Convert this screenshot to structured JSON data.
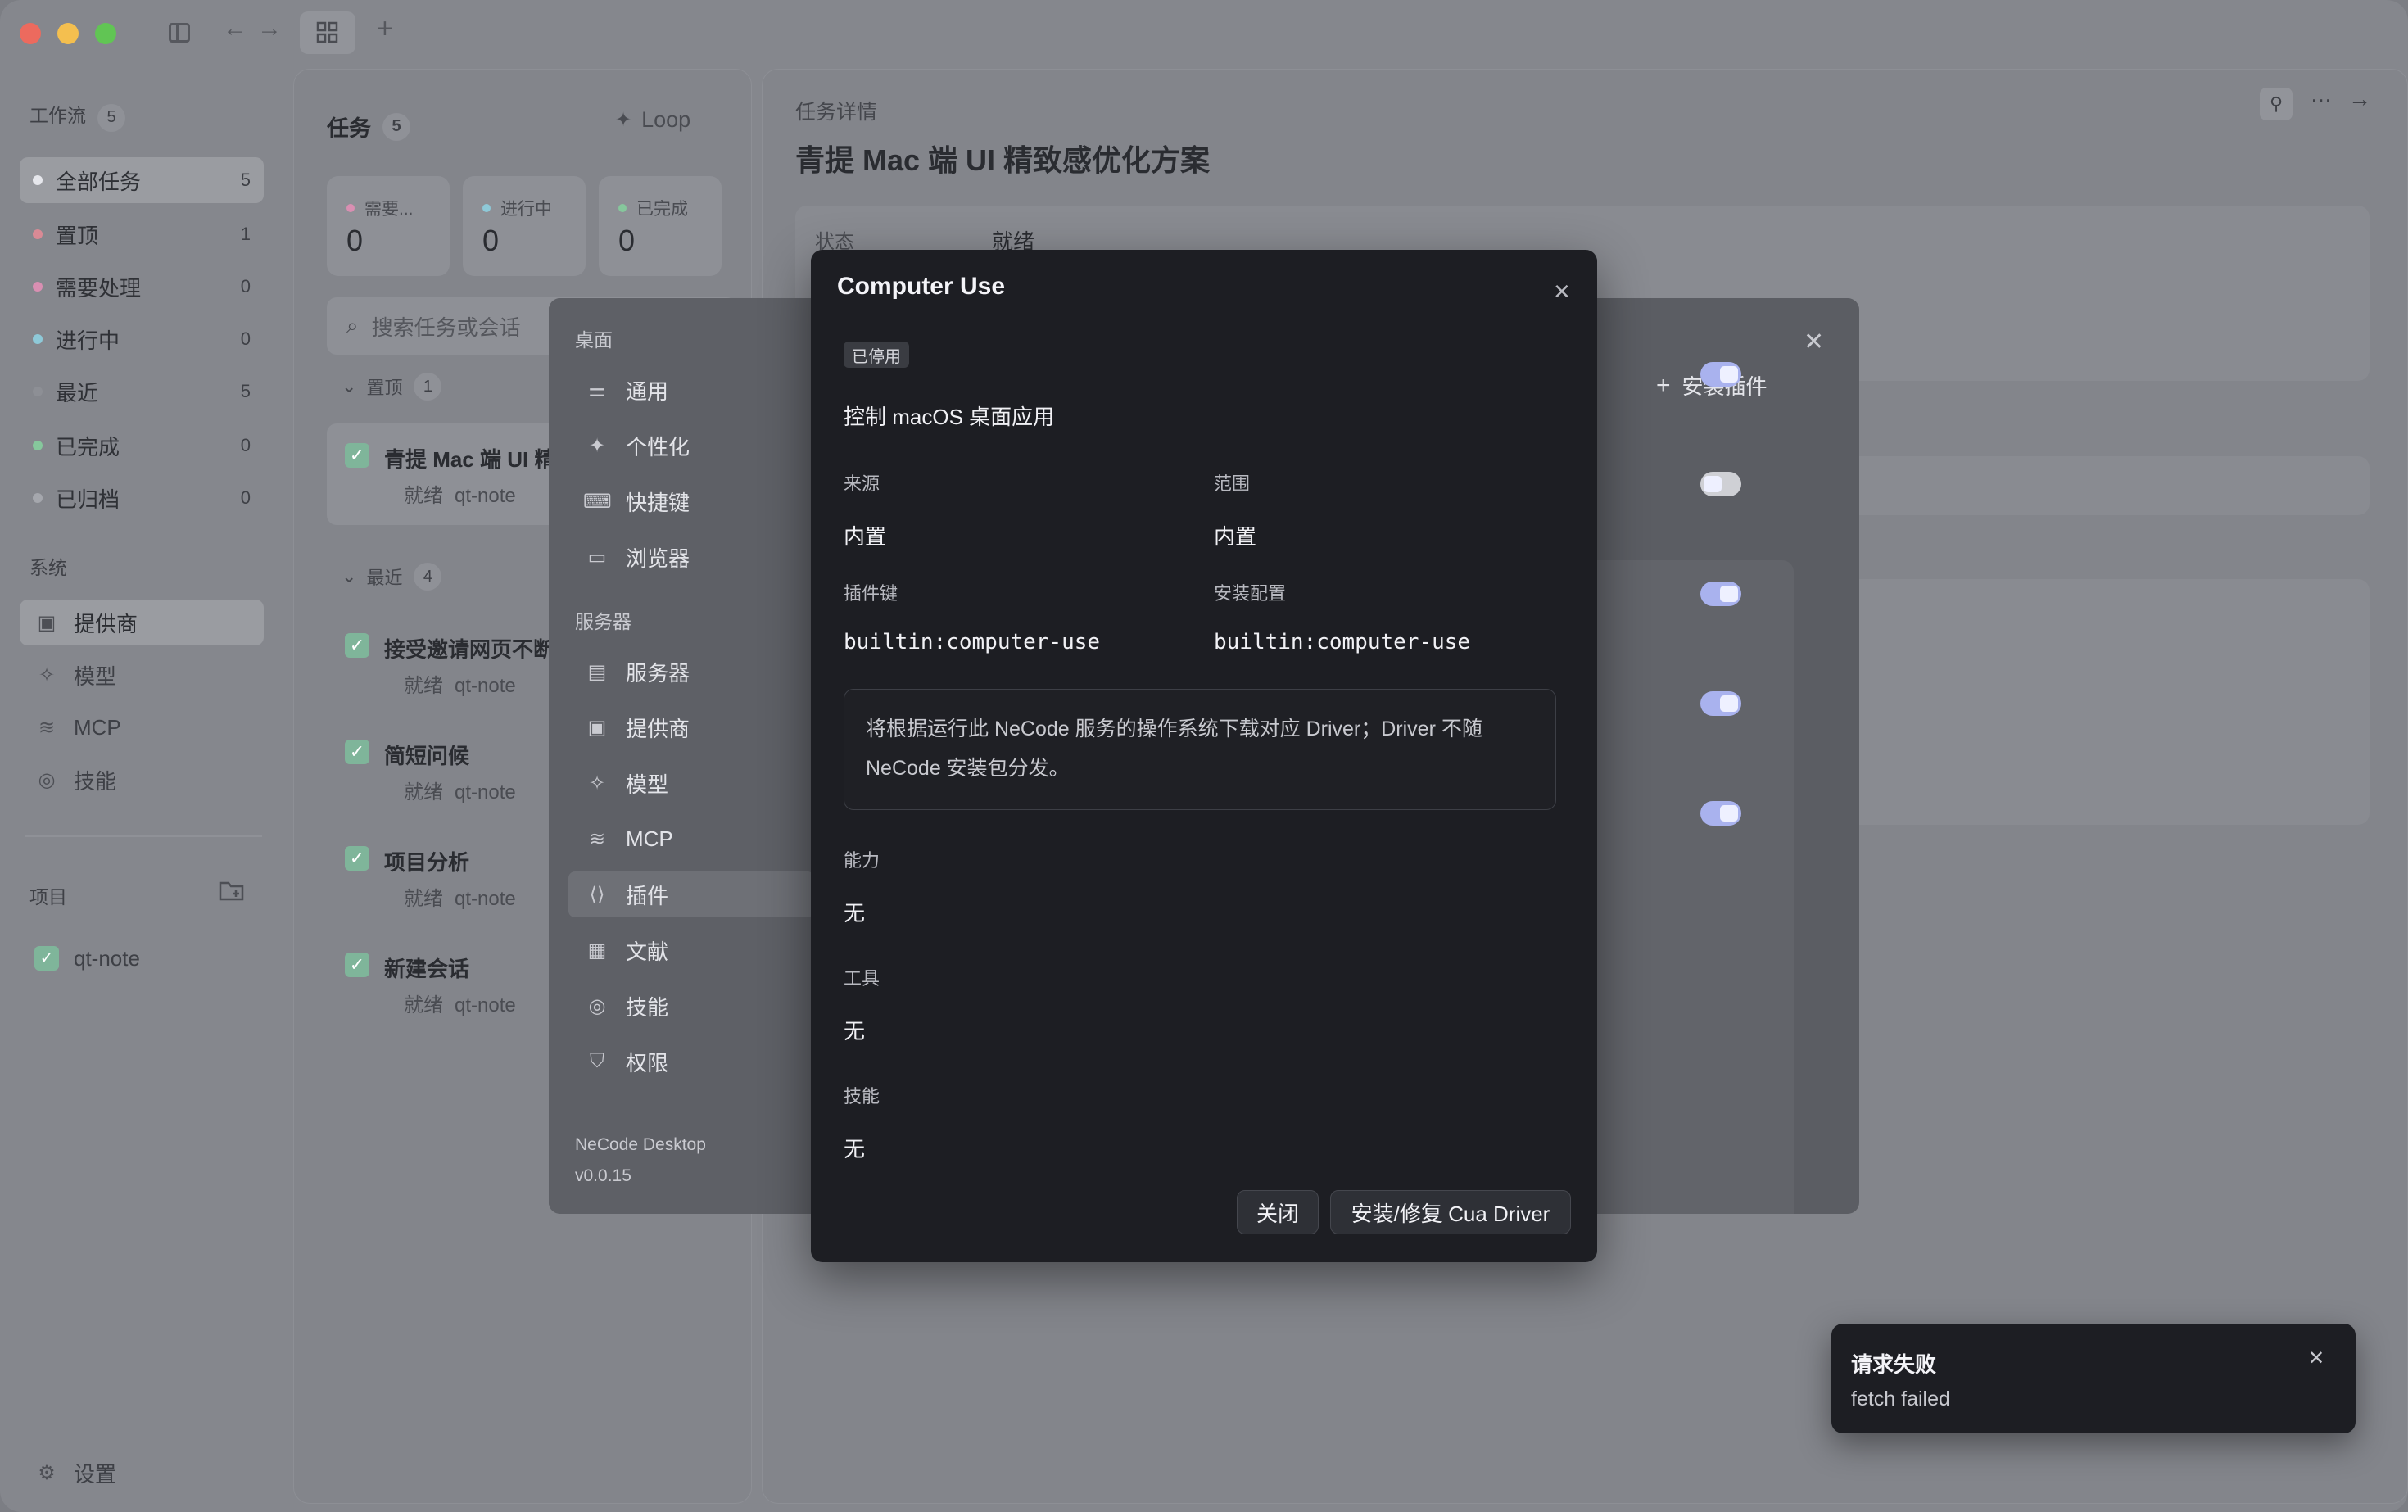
{
  "toolbar": {
    "new_tab": "+"
  },
  "sidebar": {
    "workflow_label": "工作流",
    "workflow_count": "5",
    "items": [
      {
        "label": "全部任务",
        "count": "5",
        "color": "#e6e7ec"
      },
      {
        "label": "置顶",
        "count": "1",
        "color": "#d98a95"
      },
      {
        "label": "需要处理",
        "count": "0",
        "color": "#d98fb2"
      },
      {
        "label": "进行中",
        "count": "0",
        "color": "#8ec9d8"
      },
      {
        "label": "最近",
        "count": "5",
        "color": "#8d8f95"
      },
      {
        "label": "已完成",
        "count": "0",
        "color": "#86c79c"
      },
      {
        "label": "已归档",
        "count": "0",
        "color": "#a5a7ad"
      }
    ],
    "system_label": "系统",
    "system_items": [
      {
        "label": "提供商",
        "icon": "chip-icon"
      },
      {
        "label": "模型",
        "icon": "sparkle-icon"
      },
      {
        "label": "MCP",
        "icon": "mcp-icon"
      },
      {
        "label": "技能",
        "icon": "skill-icon"
      }
    ],
    "project_label": "项目",
    "projects": [
      {
        "label": "qt-note"
      }
    ],
    "settings_label": "设置"
  },
  "tasks": {
    "title": "任务",
    "count": "5",
    "loop_label": "Loop",
    "stats": [
      {
        "label": "需要...",
        "value": "0",
        "color": "#d98fb2"
      },
      {
        "label": "进行中",
        "value": "0",
        "color": "#8ec9d8"
      },
      {
        "label": "已完成",
        "value": "0",
        "color": "#86c79c"
      }
    ],
    "search_placeholder": "搜索任务或会话",
    "pinned_group": {
      "label": "置顶",
      "count": "1"
    },
    "recent_group": {
      "label": "最近",
      "count": "4"
    },
    "pinned": [
      {
        "title": "青提 Mac 端 UI 精",
        "status": "就绪",
        "project": "qt-note"
      }
    ],
    "recent": [
      {
        "title": "接受邀请网页不断",
        "status": "就绪",
        "project": "qt-note"
      },
      {
        "title": "简短问候",
        "status": "就绪",
        "project": "qt-note"
      },
      {
        "title": "项目分析",
        "status": "就绪",
        "project": "qt-note"
      },
      {
        "title": "新建会话",
        "status": "就绪",
        "project": "qt-note"
      }
    ]
  },
  "detail": {
    "section_label": "任务详情",
    "title": "青提 Mac 端 UI 精致感优化方案",
    "status_label": "状态",
    "status_value": "就绪"
  },
  "settings": {
    "desktop_label": "桌面",
    "desktop_items": [
      {
        "label": "通用",
        "icon": "sliders-icon"
      },
      {
        "label": "个性化",
        "icon": "sparkles-icon"
      },
      {
        "label": "快捷键",
        "icon": "keyboard-icon"
      },
      {
        "label": "浏览器",
        "icon": "browser-icon"
      }
    ],
    "server_label": "服务器",
    "server_items": [
      {
        "label": "服务器",
        "icon": "server-icon"
      },
      {
        "label": "提供商",
        "icon": "chip-icon"
      },
      {
        "label": "模型",
        "icon": "sparkle-icon"
      },
      {
        "label": "MCP",
        "icon": "mcp-icon"
      },
      {
        "label": "插件",
        "icon": "plugin-icon"
      },
      {
        "label": "文献",
        "icon": "archive-icon"
      },
      {
        "label": "技能",
        "icon": "skill-icon"
      },
      {
        "label": "权限",
        "icon": "shield-icon"
      }
    ],
    "app_name": "NeCode Desktop",
    "version": "v0.0.15",
    "install_plugin_label": "安装插件",
    "toggles": [
      true,
      false,
      true,
      true,
      true
    ]
  },
  "modal": {
    "title": "Computer Use",
    "badge": "已停用",
    "description": "控制 macOS 桌面应用",
    "source_label": "来源",
    "source_value": "内置",
    "scope_label": "范围",
    "scope_value": "内置",
    "plugin_key_label": "插件键",
    "plugin_key_value": "builtin:computer-use",
    "install_config_label": "安装配置",
    "install_config_value": "builtin:computer-use",
    "notice": "将根据运行此 NeCode 服务的操作系统下载对应 Driver；Driver 不随 NeCode 安装包分发。",
    "capability_label": "能力",
    "capability_value": "无",
    "tools_label": "工具",
    "tools_value": "无",
    "skills_label": "技能",
    "skills_value": "无",
    "close_label": "关闭",
    "install_label": "安装/修复 Cua Driver"
  },
  "toast": {
    "title": "请求失败",
    "message": "fetch failed"
  }
}
